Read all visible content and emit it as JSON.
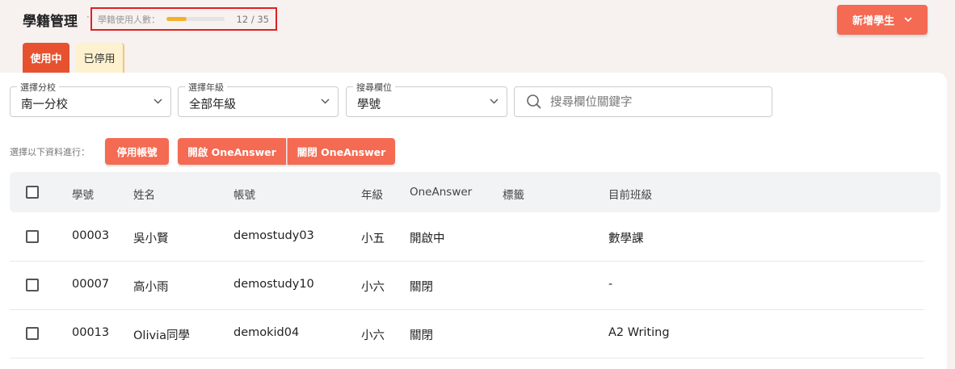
{
  "header": {
    "title": "學籍管理",
    "dot": "·",
    "usage": {
      "label": "學籍使用人數：",
      "count_text": "12 / 35",
      "used": 12,
      "total": 35,
      "fill_color": "#f5b02b"
    },
    "add_button": {
      "label": "新增學生",
      "icon": "chevron-down-icon"
    }
  },
  "tabs": [
    {
      "label": "使用中",
      "active": true
    },
    {
      "label": "已停用",
      "active": false
    }
  ],
  "filters": {
    "branch": {
      "label": "選擇分校",
      "value": "南一分校"
    },
    "grade": {
      "label": "選擇年級",
      "value": "全部年級"
    },
    "field": {
      "label": "搜尋欄位",
      "value": "學號"
    },
    "search": {
      "placeholder": "搜尋欄位關鍵字",
      "value": ""
    }
  },
  "actions": {
    "label": "選擇以下資料進行：",
    "disable_account": "停用帳號",
    "open_oneanswer": "開啟 OneAnswer",
    "close_oneanswer": "關閉 OneAnswer"
  },
  "table": {
    "columns": [
      "學號",
      "姓名",
      "帳號",
      "年級",
      "OneAnswer",
      "標籤",
      "目前班級"
    ],
    "rows": [
      {
        "id": "00003",
        "name": "吳小賢",
        "account": "demostudy03",
        "grade": "小五",
        "oneanswer": "開啟中",
        "tags": "",
        "class": "數學課"
      },
      {
        "id": "00007",
        "name": "高小雨",
        "account": "demostudy10",
        "grade": "小六",
        "oneanswer": "關閉",
        "tags": "",
        "class": "-"
      },
      {
        "id": "00013",
        "name": "Olivia同學",
        "account": "demokid04",
        "grade": "小六",
        "oneanswer": "關閉",
        "tags": "",
        "class": "A2 Writing"
      }
    ]
  },
  "colors": {
    "accent": "#f46a52",
    "tab_active": "#e8512f",
    "tab_inactive": "#fdf1cf",
    "highlight_box": "#e02020"
  }
}
